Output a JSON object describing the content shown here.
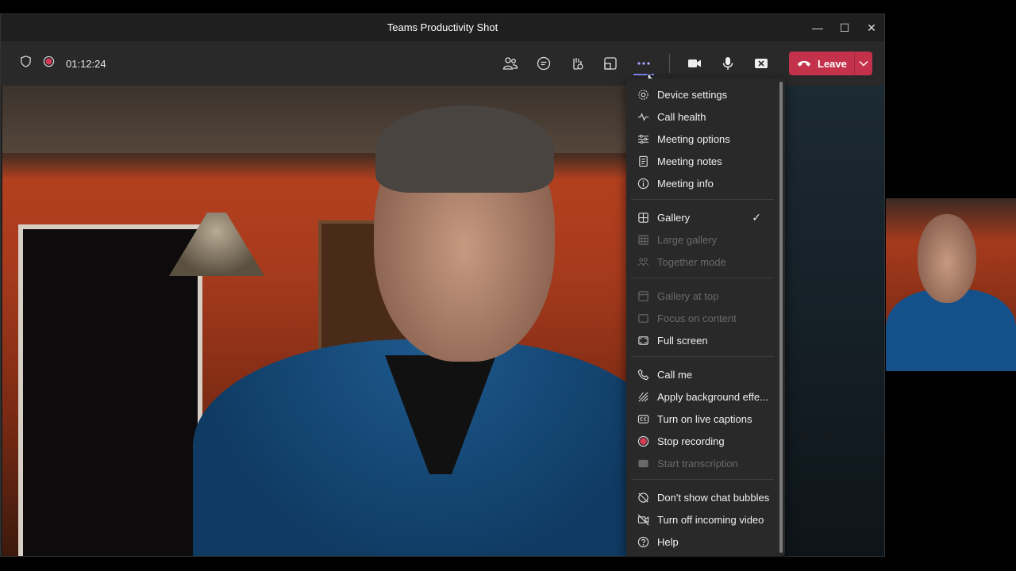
{
  "window": {
    "title": "Teams Productivity Shot",
    "controls": {
      "minimize": "—",
      "maximize": "☐",
      "close": "✕"
    }
  },
  "toolbar": {
    "timer": "01:12:24",
    "leave_label": "Leave",
    "accent": "#c4314b"
  },
  "menu": {
    "groups": [
      [
        {
          "label": "Device settings",
          "icon": "gear-icon"
        },
        {
          "label": "Call health",
          "icon": "pulse-icon"
        },
        {
          "label": "Meeting options",
          "icon": "sliders-icon"
        },
        {
          "label": "Meeting notes",
          "icon": "notes-icon"
        },
        {
          "label": "Meeting info",
          "icon": "info-icon"
        }
      ],
      [
        {
          "label": "Gallery",
          "icon": "grid-icon",
          "checked": true
        },
        {
          "label": "Large gallery",
          "icon": "large-grid-icon",
          "disabled": true
        },
        {
          "label": "Together mode",
          "icon": "people-icon",
          "disabled": true
        }
      ],
      [
        {
          "label": "Gallery at top",
          "icon": "gallery-top-icon",
          "disabled": true
        },
        {
          "label": "Focus on content",
          "icon": "focus-icon",
          "disabled": true
        },
        {
          "label": "Full screen",
          "icon": "fullscreen-icon"
        }
      ],
      [
        {
          "label": "Call me",
          "icon": "phone-icon"
        },
        {
          "label": "Apply background effe...",
          "icon": "background-icon"
        },
        {
          "label": "Turn on live captions",
          "icon": "captions-icon"
        },
        {
          "label": "Stop recording",
          "icon": "record-icon"
        },
        {
          "label": "Start transcription",
          "icon": "transcript-icon",
          "disabled": true
        }
      ],
      [
        {
          "label": "Don't show chat bubbles",
          "icon": "no-chat-icon"
        },
        {
          "label": "Turn off incoming video",
          "icon": "no-video-icon"
        },
        {
          "label": "Help",
          "icon": "help-icon"
        }
      ]
    ],
    "checkmark": "✓"
  }
}
